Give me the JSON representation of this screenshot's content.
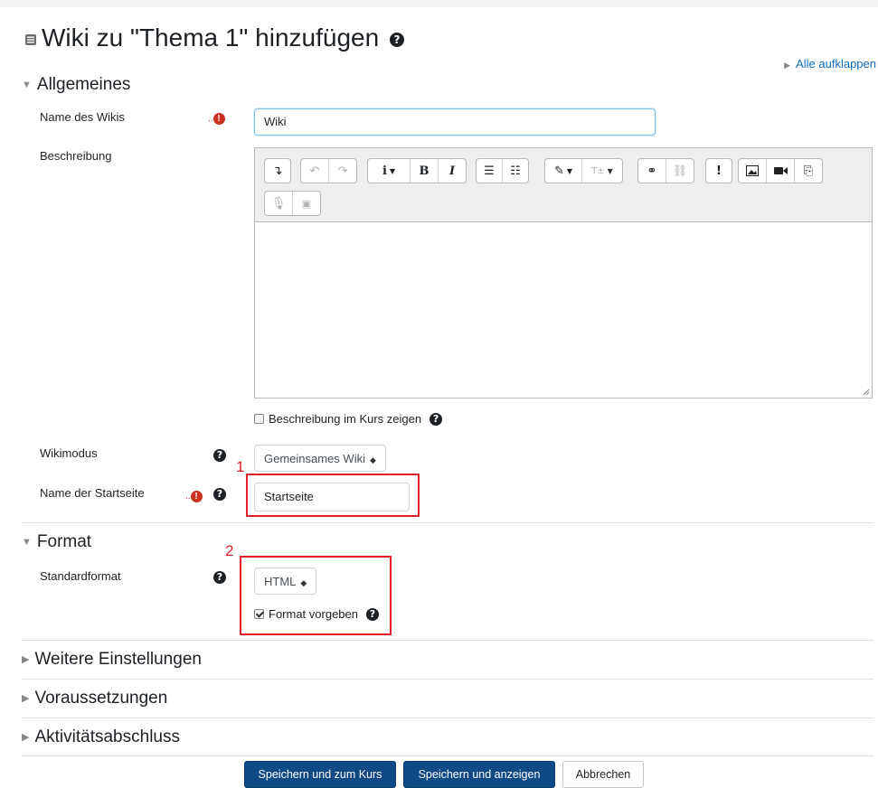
{
  "page": {
    "title": "Wiki zu \"Thema 1\" hinzufügen",
    "expand_all": "Alle aufklappen"
  },
  "sections": {
    "general": "Allgemeines",
    "format": "Format",
    "more_settings": "Weitere Einstellungen",
    "restrictions": "Voraussetzungen",
    "completion": "Aktivitätsabschluss"
  },
  "fields": {
    "wiki_name": {
      "label": "Name des Wikis",
      "value": "Wiki"
    },
    "description": {
      "label": "Beschreibung"
    },
    "show_description": {
      "label": "Beschreibung im Kurs zeigen",
      "checked": false
    },
    "wiki_mode": {
      "label": "Wikimodus",
      "value": "Gemeinsames Wiki"
    },
    "start_page": {
      "label": "Name der Startseite",
      "value": "Startseite"
    },
    "default_format": {
      "label": "Standardformat",
      "value": "HTML"
    },
    "force_format": {
      "label": "Format vorgeben",
      "checked": true
    }
  },
  "annotations": {
    "marker1": "1",
    "marker2": "2"
  },
  "buttons": {
    "save_return": "Speichern und zum Kurs",
    "save_display": "Speichern und anzeigen",
    "cancel": "Abbrechen"
  },
  "icons": {
    "help": "?",
    "required": "!",
    "section_expanded": "▼",
    "section_collapsed": "▶"
  },
  "colors": {
    "primary_button": "#0f4a86",
    "link": "#0f6cbf",
    "required": "#ca3120",
    "annotation": "#e0202a"
  }
}
